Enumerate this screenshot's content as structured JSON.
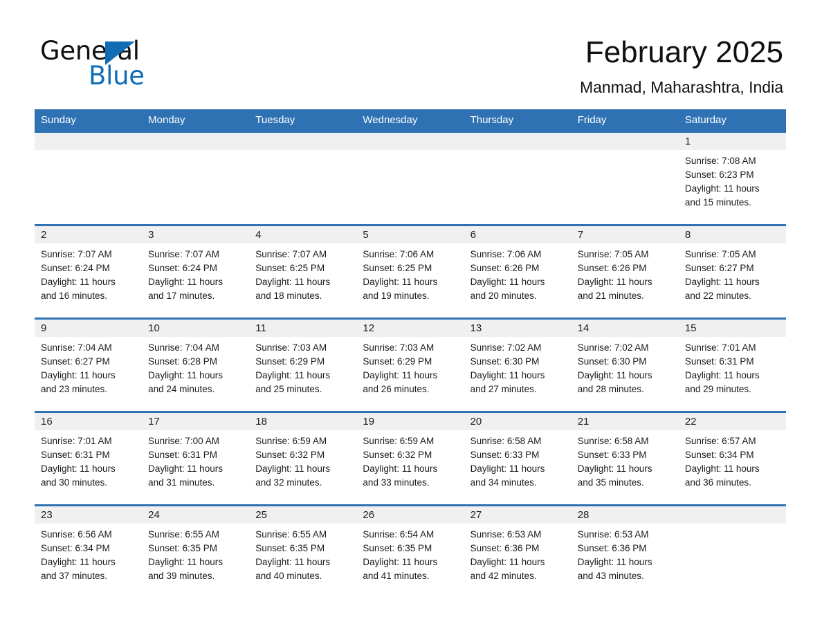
{
  "brand": {
    "name_part1": "General",
    "name_part2": "Blue",
    "triangle_color": "#0f6cb5",
    "accent_color": "#2f72b4"
  },
  "header": {
    "title": "February 2025",
    "location": "Manmad, Maharashtra, India"
  },
  "calendar": {
    "weekday_headers": [
      "Sunday",
      "Monday",
      "Tuesday",
      "Wednesday",
      "Thursday",
      "Friday",
      "Saturday"
    ],
    "header_bg": "#2f72b4",
    "daynum_bg": "#f0f0f0",
    "weeks": [
      [
        {
          "day": "",
          "sunrise": "",
          "sunset": "",
          "daylight_1": "",
          "daylight_2": ""
        },
        {
          "day": "",
          "sunrise": "",
          "sunset": "",
          "daylight_1": "",
          "daylight_2": ""
        },
        {
          "day": "",
          "sunrise": "",
          "sunset": "",
          "daylight_1": "",
          "daylight_2": ""
        },
        {
          "day": "",
          "sunrise": "",
          "sunset": "",
          "daylight_1": "",
          "daylight_2": ""
        },
        {
          "day": "",
          "sunrise": "",
          "sunset": "",
          "daylight_1": "",
          "daylight_2": ""
        },
        {
          "day": "",
          "sunrise": "",
          "sunset": "",
          "daylight_1": "",
          "daylight_2": ""
        },
        {
          "day": "1",
          "sunrise": "Sunrise: 7:08 AM",
          "sunset": "Sunset: 6:23 PM",
          "daylight_1": "Daylight: 11 hours",
          "daylight_2": "and 15 minutes."
        }
      ],
      [
        {
          "day": "2",
          "sunrise": "Sunrise: 7:07 AM",
          "sunset": "Sunset: 6:24 PM",
          "daylight_1": "Daylight: 11 hours",
          "daylight_2": "and 16 minutes."
        },
        {
          "day": "3",
          "sunrise": "Sunrise: 7:07 AM",
          "sunset": "Sunset: 6:24 PM",
          "daylight_1": "Daylight: 11 hours",
          "daylight_2": "and 17 minutes."
        },
        {
          "day": "4",
          "sunrise": "Sunrise: 7:07 AM",
          "sunset": "Sunset: 6:25 PM",
          "daylight_1": "Daylight: 11 hours",
          "daylight_2": "and 18 minutes."
        },
        {
          "day": "5",
          "sunrise": "Sunrise: 7:06 AM",
          "sunset": "Sunset: 6:25 PM",
          "daylight_1": "Daylight: 11 hours",
          "daylight_2": "and 19 minutes."
        },
        {
          "day": "6",
          "sunrise": "Sunrise: 7:06 AM",
          "sunset": "Sunset: 6:26 PM",
          "daylight_1": "Daylight: 11 hours",
          "daylight_2": "and 20 minutes."
        },
        {
          "day": "7",
          "sunrise": "Sunrise: 7:05 AM",
          "sunset": "Sunset: 6:26 PM",
          "daylight_1": "Daylight: 11 hours",
          "daylight_2": "and 21 minutes."
        },
        {
          "day": "8",
          "sunrise": "Sunrise: 7:05 AM",
          "sunset": "Sunset: 6:27 PM",
          "daylight_1": "Daylight: 11 hours",
          "daylight_2": "and 22 minutes."
        }
      ],
      [
        {
          "day": "9",
          "sunrise": "Sunrise: 7:04 AM",
          "sunset": "Sunset: 6:27 PM",
          "daylight_1": "Daylight: 11 hours",
          "daylight_2": "and 23 minutes."
        },
        {
          "day": "10",
          "sunrise": "Sunrise: 7:04 AM",
          "sunset": "Sunset: 6:28 PM",
          "daylight_1": "Daylight: 11 hours",
          "daylight_2": "and 24 minutes."
        },
        {
          "day": "11",
          "sunrise": "Sunrise: 7:03 AM",
          "sunset": "Sunset: 6:29 PM",
          "daylight_1": "Daylight: 11 hours",
          "daylight_2": "and 25 minutes."
        },
        {
          "day": "12",
          "sunrise": "Sunrise: 7:03 AM",
          "sunset": "Sunset: 6:29 PM",
          "daylight_1": "Daylight: 11 hours",
          "daylight_2": "and 26 minutes."
        },
        {
          "day": "13",
          "sunrise": "Sunrise: 7:02 AM",
          "sunset": "Sunset: 6:30 PM",
          "daylight_1": "Daylight: 11 hours",
          "daylight_2": "and 27 minutes."
        },
        {
          "day": "14",
          "sunrise": "Sunrise: 7:02 AM",
          "sunset": "Sunset: 6:30 PM",
          "daylight_1": "Daylight: 11 hours",
          "daylight_2": "and 28 minutes."
        },
        {
          "day": "15",
          "sunrise": "Sunrise: 7:01 AM",
          "sunset": "Sunset: 6:31 PM",
          "daylight_1": "Daylight: 11 hours",
          "daylight_2": "and 29 minutes."
        }
      ],
      [
        {
          "day": "16",
          "sunrise": "Sunrise: 7:01 AM",
          "sunset": "Sunset: 6:31 PM",
          "daylight_1": "Daylight: 11 hours",
          "daylight_2": "and 30 minutes."
        },
        {
          "day": "17",
          "sunrise": "Sunrise: 7:00 AM",
          "sunset": "Sunset: 6:31 PM",
          "daylight_1": "Daylight: 11 hours",
          "daylight_2": "and 31 minutes."
        },
        {
          "day": "18",
          "sunrise": "Sunrise: 6:59 AM",
          "sunset": "Sunset: 6:32 PM",
          "daylight_1": "Daylight: 11 hours",
          "daylight_2": "and 32 minutes."
        },
        {
          "day": "19",
          "sunrise": "Sunrise: 6:59 AM",
          "sunset": "Sunset: 6:32 PM",
          "daylight_1": "Daylight: 11 hours",
          "daylight_2": "and 33 minutes."
        },
        {
          "day": "20",
          "sunrise": "Sunrise: 6:58 AM",
          "sunset": "Sunset: 6:33 PM",
          "daylight_1": "Daylight: 11 hours",
          "daylight_2": "and 34 minutes."
        },
        {
          "day": "21",
          "sunrise": "Sunrise: 6:58 AM",
          "sunset": "Sunset: 6:33 PM",
          "daylight_1": "Daylight: 11 hours",
          "daylight_2": "and 35 minutes."
        },
        {
          "day": "22",
          "sunrise": "Sunrise: 6:57 AM",
          "sunset": "Sunset: 6:34 PM",
          "daylight_1": "Daylight: 11 hours",
          "daylight_2": "and 36 minutes."
        }
      ],
      [
        {
          "day": "23",
          "sunrise": "Sunrise: 6:56 AM",
          "sunset": "Sunset: 6:34 PM",
          "daylight_1": "Daylight: 11 hours",
          "daylight_2": "and 37 minutes."
        },
        {
          "day": "24",
          "sunrise": "Sunrise: 6:55 AM",
          "sunset": "Sunset: 6:35 PM",
          "daylight_1": "Daylight: 11 hours",
          "daylight_2": "and 39 minutes."
        },
        {
          "day": "25",
          "sunrise": "Sunrise: 6:55 AM",
          "sunset": "Sunset: 6:35 PM",
          "daylight_1": "Daylight: 11 hours",
          "daylight_2": "and 40 minutes."
        },
        {
          "day": "26",
          "sunrise": "Sunrise: 6:54 AM",
          "sunset": "Sunset: 6:35 PM",
          "daylight_1": "Daylight: 11 hours",
          "daylight_2": "and 41 minutes."
        },
        {
          "day": "27",
          "sunrise": "Sunrise: 6:53 AM",
          "sunset": "Sunset: 6:36 PM",
          "daylight_1": "Daylight: 11 hours",
          "daylight_2": "and 42 minutes."
        },
        {
          "day": "28",
          "sunrise": "Sunrise: 6:53 AM",
          "sunset": "Sunset: 6:36 PM",
          "daylight_1": "Daylight: 11 hours",
          "daylight_2": "and 43 minutes."
        },
        {
          "day": "",
          "sunrise": "",
          "sunset": "",
          "daylight_1": "",
          "daylight_2": ""
        }
      ]
    ]
  }
}
